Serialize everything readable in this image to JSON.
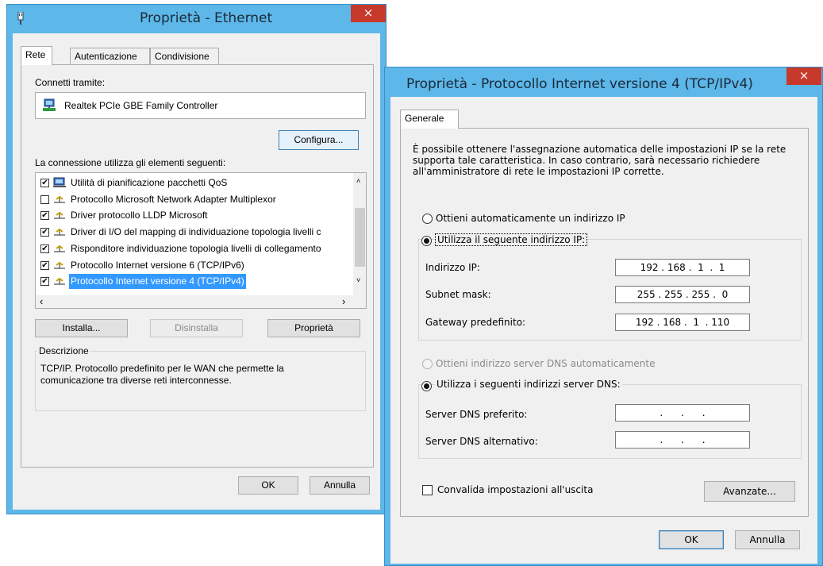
{
  "eth": {
    "title": "Proprietà - Ethernet",
    "close": "×",
    "tabs": [
      "Rete",
      "Autenticazione",
      "Condivisione"
    ],
    "connect_label": "Connetti tramite:",
    "adapter": "Realtek PCIe GBE Family Controller",
    "configure": "Configura...",
    "items_label": "La connessione utilizza gli elementi seguenti:",
    "items": [
      {
        "label": "Utilità di pianificazione pacchetti QoS",
        "checked": true,
        "icon": "qos-scheduler-icon"
      },
      {
        "label": "Protocollo Microsoft Network Adapter Multiplexor",
        "checked": false,
        "icon": "protocol-icon"
      },
      {
        "label": "Driver protocollo LLDP Microsoft",
        "checked": true,
        "icon": "protocol-icon"
      },
      {
        "label": "Driver di I/O del mapping di individuazione topologia livelli c",
        "checked": true,
        "icon": "protocol-icon"
      },
      {
        "label": "Risponditore individuazione topologia livelli di collegamento",
        "checked": true,
        "icon": "protocol-icon"
      },
      {
        "label": "Protocollo Internet versione 6 (TCP/IPv6)",
        "checked": true,
        "icon": "protocol-icon"
      },
      {
        "label": "Protocollo Internet versione 4 (TCP/IPv4)",
        "checked": true,
        "icon": "protocol-icon",
        "selected": true
      }
    ],
    "install": "Installa...",
    "uninstall": "Disinstalla",
    "properties": "Proprietà",
    "description_label": "Descrizione",
    "description": "TCP/IP. Protocollo predefinito per le WAN che permette la comunicazione tra diverse reti interconnesse.",
    "ok": "OK",
    "cancel": "Annulla"
  },
  "ipv4": {
    "title": "Proprietà - Protocollo Internet versione 4 (TCP/IPv4)",
    "close": "×",
    "tab": "Generale",
    "intro": "È possibile ottenere l'assegnazione automatica delle impostazioni IP se la rete supporta tale caratteristica. In caso contrario, sarà necessario richiedere all'amministratore di rete le impostazioni IP corrette.",
    "auto_ip": "Ottieni automaticamente un indirizzo IP",
    "manual_ip": "Utilizza il seguente indirizzo IP:",
    "ip_label": "Indirizzo IP:",
    "ip_value": "192 . 168 .  1  .  1",
    "mask_label": "Subnet mask:",
    "mask_value": "255 . 255 . 255 .  0",
    "gw_label": "Gateway predefinito:",
    "gw_value": "192 . 168 .  1  . 110",
    "auto_dns": "Ottieni indirizzo server DNS automaticamente",
    "manual_dns": "Utilizza i seguenti indirizzi server DNS:",
    "dns1_label": "Server DNS preferito:",
    "dns1_value": "    .      .      .    ",
    "dns2_label": "Server DNS alternativo:",
    "dns2_value": "    .      .      .    ",
    "validate": "Convalida impostazioni all'uscita",
    "advanced": "Avanzate...",
    "ok": "OK",
    "cancel": "Annulla"
  }
}
